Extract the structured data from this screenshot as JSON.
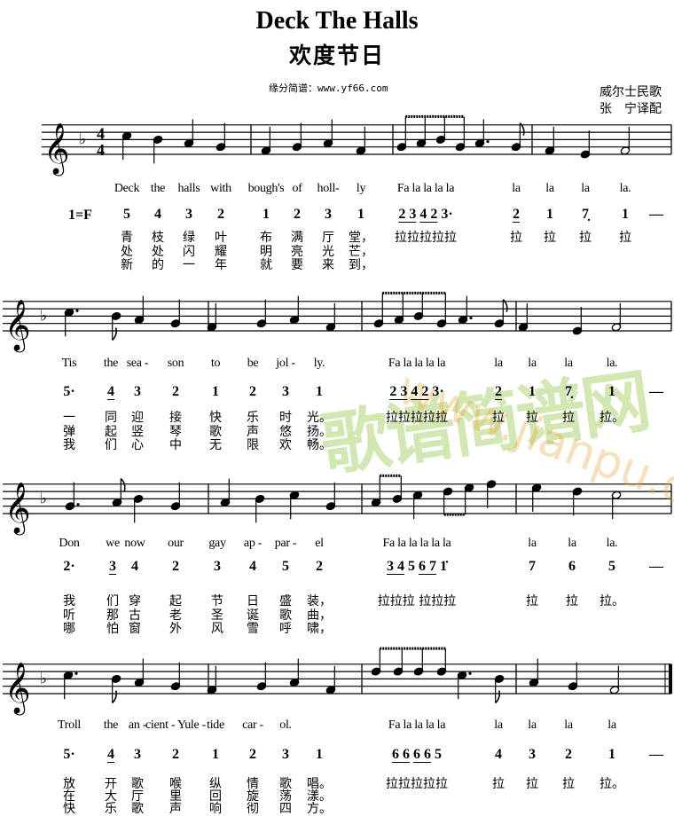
{
  "header": {
    "title": "Deck The Halls",
    "subtitle": "欢度节日",
    "source": "缘分简谱：www.yf66.com",
    "origin": "威尔士民歌",
    "arranger": "张　宁译配"
  },
  "key": "1=F",
  "time_signature": {
    "top": "4",
    "bottom": "4"
  },
  "clef": "treble",
  "key_signature": "one-flat",
  "watermark": {
    "cn": "歌谱简谱网",
    "url": "www.jianpu.cn",
    "colors": [
      "#9ccc55",
      "#e8a83a"
    ]
  },
  "systems": [
    {
      "english": [
        "Deck",
        "the",
        "halls",
        "with",
        "bough's",
        "of",
        "holl-",
        "ly",
        "Fa la la la la",
        "la",
        "la",
        "la",
        "la."
      ],
      "jianpu": [
        "5",
        "4",
        "3",
        "2",
        "1",
        "2",
        "3",
        "1",
        [
          {
            "t": "2 3",
            "u": true
          },
          {
            "t": "4 2",
            "u": true
          },
          {
            "t": "3·"
          }
        ],
        {
          "t": "2",
          "u": true
        },
        "1",
        "7̣",
        "1",
        "—"
      ],
      "chinese": [
        [
          "青",
          "枝",
          "绿",
          "叶",
          "布",
          "满",
          "厅",
          "堂，",
          "拉拉拉拉拉",
          "拉",
          "拉",
          "拉",
          "拉"
        ],
        [
          "处",
          "处",
          "闪",
          "耀",
          "明",
          "亮",
          "光",
          "芒，"
        ],
        [
          "新",
          "的",
          "一",
          "年",
          "就",
          "要",
          "来",
          "到，"
        ]
      ]
    },
    {
      "english": [
        "Tis",
        "the",
        "sea -",
        "son",
        "to",
        "be",
        "jol -",
        "ly.",
        "Fa la la la la",
        "la",
        "la",
        "la",
        "la."
      ],
      "jianpu": [
        "5·",
        {
          "t": "4",
          "u": true
        },
        "3",
        "2",
        "1",
        "2",
        "3",
        "1",
        [
          {
            "t": "2 3",
            "u": true
          },
          {
            "t": "4 2",
            "u": true
          },
          {
            "t": "3·"
          }
        ],
        {
          "t": "2",
          "u": true
        },
        "1",
        "7̣",
        "1",
        "—"
      ],
      "chinese": [
        [
          "一",
          "同",
          "迎",
          "接",
          "快",
          "乐",
          "时",
          "光。",
          "拉拉拉拉拉",
          "拉",
          "拉",
          "拉",
          "拉。"
        ],
        [
          "弹",
          "起",
          "竖",
          "琴",
          "歌",
          "声",
          "悠",
          "扬。"
        ],
        [
          "我",
          "们",
          "心",
          "中",
          "无",
          "限",
          "欢",
          "畅。"
        ]
      ]
    },
    {
      "english": [
        "Don",
        "we",
        "now",
        "our",
        "gay",
        "ap -",
        "par -",
        "el",
        "Fa la la  la la la",
        "la",
        "la",
        "la."
      ],
      "jianpu": [
        "2·",
        {
          "t": "3",
          "u": true
        },
        "4",
        "2",
        "3",
        "4",
        "5",
        "2",
        [
          {
            "t": "3 4",
            "u": true
          },
          {
            "t": "5"
          },
          {
            "t": "6 7",
            "u": true
          },
          {
            "t": "1̇"
          }
        ],
        "7",
        "6",
        "5",
        "—"
      ],
      "chinese": [
        [
          "我",
          "们",
          "穿",
          "起",
          "节",
          "日",
          "盛",
          "装，",
          "拉拉拉 拉拉拉",
          "拉",
          "拉",
          "拉。"
        ],
        [
          "听",
          "那",
          "古",
          "老",
          "圣",
          "诞",
          "歌",
          "曲，"
        ],
        [
          "哪",
          "怕",
          "窗",
          "外",
          "风",
          "雪",
          "呼",
          "啸，"
        ]
      ]
    },
    {
      "english": [
        "Troll",
        "the",
        "an -",
        "cient - Yule -",
        "tide",
        "car -",
        "ol.",
        "",
        "Fa la la la la",
        "la",
        "la",
        "la",
        "la"
      ],
      "jianpu": [
        "5·",
        {
          "t": "4",
          "u": true
        },
        "3",
        "2",
        "1",
        "2",
        "3",
        "1",
        [
          {
            "t": "6 6",
            "u": true
          },
          {
            "t": "6 6",
            "u": true
          },
          {
            "t": "5"
          }
        ],
        "4",
        "3",
        "2",
        "1",
        "—"
      ],
      "chinese": [
        [
          "放",
          "开",
          "歌",
          "喉",
          "纵",
          "情",
          "歌",
          "唱。",
          "拉拉拉拉拉",
          "拉",
          "拉",
          "拉",
          "拉。"
        ],
        [
          "在",
          "大",
          "厅",
          "里",
          "回",
          "旋",
          "荡",
          "漾。"
        ],
        [
          "快",
          "乐",
          "歌",
          "声",
          "响",
          "彻",
          "四",
          "方。"
        ]
      ]
    }
  ]
}
